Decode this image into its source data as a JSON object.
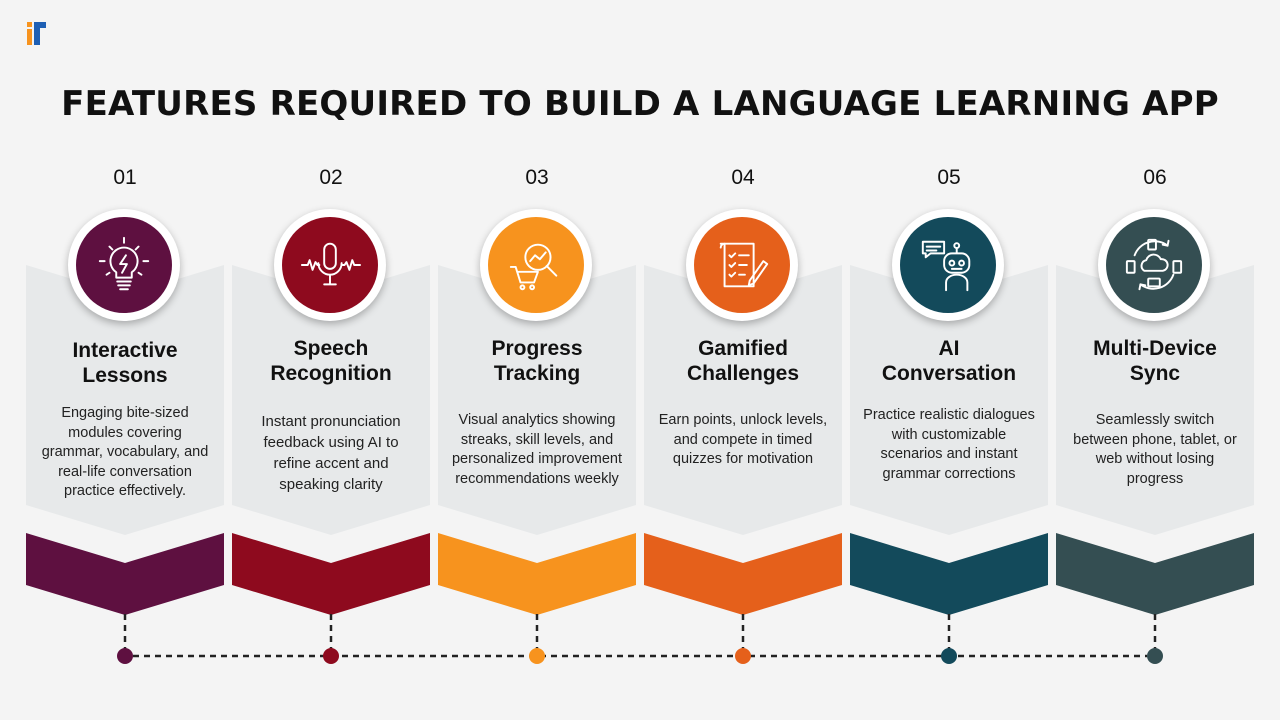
{
  "title": "FEATURES REQUIRED TO BUILD A LANGUAGE LEARNING APP",
  "features": [
    {
      "number": "01",
      "heading_line1": "Interactive",
      "heading_line2": "Lessons",
      "description": "Engaging bite-sized modules covering grammar, vocabulary, and real-life conversation practice effectively.",
      "color": "#5e1040",
      "icon": "lightbulb-icon"
    },
    {
      "number": "02",
      "heading_line1": "Speech",
      "heading_line2": "Recognition",
      "description": "Instant pronunciation feedback using AI to refine accent and speaking clarity",
      "color": "#8e0a1e",
      "icon": "microphone-icon"
    },
    {
      "number": "03",
      "heading_line1": "Progress",
      "heading_line2": "Tracking",
      "description": "Visual analytics showing streaks, skill levels, and personalized improvement recommendations weekly",
      "color": "#f7931e",
      "icon": "analytics-cart-icon"
    },
    {
      "number": "04",
      "heading_line1": "Gamified",
      "heading_line2": "Challenges",
      "description": "Earn points, unlock levels, and compete in timed quizzes for motivation",
      "color": "#e5601b",
      "icon": "checklist-icon"
    },
    {
      "number": "05",
      "heading_line1": "AI",
      "heading_line2": "Conversation",
      "description": "Practice realistic dialogues with customizable scenarios and instant grammar corrections",
      "color": "#134a5b",
      "icon": "chatbot-icon"
    },
    {
      "number": "06",
      "heading_line1": "Multi-Device",
      "heading_line2": "Sync",
      "description": "Seamlessly switch between phone, tablet, or web without losing progress",
      "color": "#344e52",
      "icon": "device-sync-icon"
    }
  ]
}
